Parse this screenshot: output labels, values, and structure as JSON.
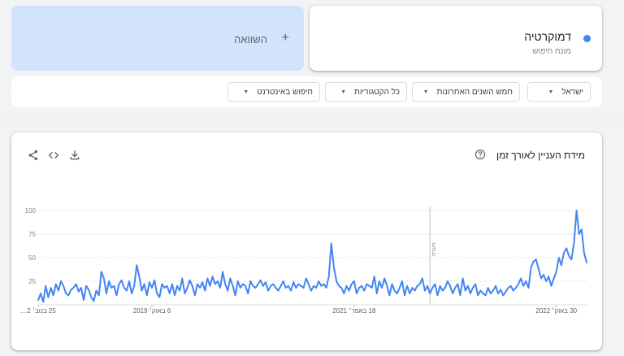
{
  "search_term": {
    "name": "דמוקרטיה",
    "type_label": "מונח חיפוש",
    "color": "#4285f4"
  },
  "compare": {
    "label": "השוואה",
    "plus": "+"
  },
  "filters": [
    {
      "label": "ישראל"
    },
    {
      "label": "חמש השנים האחרונות"
    },
    {
      "label": "כל הקטגוריות"
    },
    {
      "label": "חיפוש באינטרנט"
    }
  ],
  "chart": {
    "title": "מידת העניין לאורך זמן",
    "note": "הערה",
    "icons": [
      "help-icon",
      "download-icon",
      "embed-icon",
      "share-icon"
    ]
  },
  "chart_data": {
    "type": "line",
    "ylim": [
      0,
      100
    ],
    "y_ticks": [
      "100",
      "75",
      "50",
      "25"
    ],
    "x_tick_labels": [
      "25 בנוב׳ 2…",
      "6 באוק׳ 2019",
      "18 באפר׳ 2021",
      "30 באוק׳ 2022"
    ],
    "x_tick_week_index": [
      0,
      45,
      125,
      205
    ],
    "note_week_index": [
      155
    ],
    "grid": true,
    "legend": "none",
    "series": [
      {
        "values": [
          5,
          12,
          3,
          20,
          8,
          18,
          10,
          22,
          15,
          25,
          20,
          12,
          10,
          16,
          18,
          22,
          14,
          18,
          5,
          20,
          16,
          8,
          4,
          15,
          10,
          35,
          28,
          12,
          25,
          18,
          20,
          10,
          22,
          26,
          18,
          15,
          25,
          12,
          20,
          42,
          30,
          15,
          22,
          10,
          24,
          18,
          26,
          12,
          8,
          22,
          18,
          20,
          12,
          22,
          10,
          20,
          15,
          28,
          12,
          18,
          26,
          20,
          10,
          22,
          18,
          24,
          15,
          28,
          20,
          30,
          22,
          25,
          18,
          35,
          22,
          15,
          28,
          20,
          10,
          25,
          18,
          22,
          20,
          12,
          25,
          20,
          18,
          22,
          26,
          20,
          24,
          15,
          20,
          22,
          18,
          15,
          20,
          25,
          18,
          20,
          15,
          24,
          18,
          22,
          20,
          18,
          28,
          22,
          15,
          20,
          18,
          25,
          20,
          22,
          18,
          30,
          65,
          40,
          25,
          20,
          18,
          12,
          20,
          15,
          22,
          25,
          12,
          18,
          20,
          15,
          22,
          20,
          18,
          30,
          12,
          25,
          18,
          28,
          20,
          10,
          22,
          15,
          12,
          18,
          25,
          10,
          20,
          12,
          18,
          15,
          20,
          22,
          28,
          15,
          20,
          12,
          18,
          22,
          10,
          20,
          15,
          18,
          25,
          20,
          12,
          18,
          22,
          10,
          28,
          15,
          20,
          12,
          18,
          22,
          10,
          15,
          12,
          10,
          18,
          12,
          15,
          20,
          12,
          16,
          10,
          14,
          18,
          20,
          15,
          18,
          22,
          28,
          20,
          25,
          18,
          40,
          46,
          48,
          38,
          28,
          32,
          25,
          30,
          20,
          28,
          35,
          50,
          42,
          55,
          60,
          52,
          48,
          65,
          100,
          75,
          80,
          55,
          45
        ],
        "color": "#4285f4"
      }
    ]
  }
}
